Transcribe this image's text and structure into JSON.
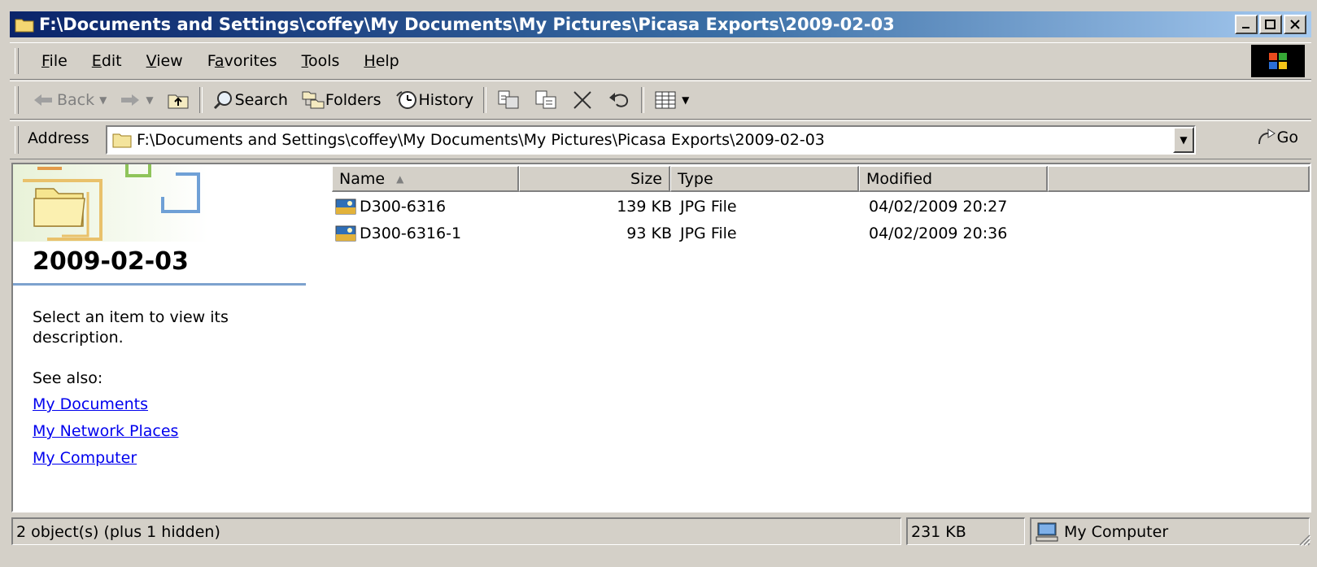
{
  "window": {
    "title": "F:\\Documents and Settings\\coffey\\My Documents\\My Pictures\\Picasa Exports\\2009-02-03"
  },
  "menu": [
    {
      "label": "File",
      "key": "F"
    },
    {
      "label": "Edit",
      "key": "E"
    },
    {
      "label": "View",
      "key": "V"
    },
    {
      "label": "Favorites",
      "key": "a"
    },
    {
      "label": "Tools",
      "key": "T"
    },
    {
      "label": "Help",
      "key": "H"
    }
  ],
  "toolbar": {
    "back_label": "Back",
    "search_label": "Search",
    "folders_label": "Folders",
    "history_label": "History"
  },
  "address": {
    "label": "Address",
    "value": "F:\\Documents and Settings\\coffey\\My Documents\\My Pictures\\Picasa Exports\\2009-02-03",
    "go_label": "Go"
  },
  "left_pane": {
    "folder_title": "2009-02-03",
    "description": "Select an item to view its description.",
    "see_also_label": "See also:",
    "links": [
      "My Documents",
      "My Network Places",
      "My Computer"
    ]
  },
  "columns": {
    "name": "Name",
    "size": "Size",
    "type": "Type",
    "modified": "Modified"
  },
  "files": [
    {
      "name": "D300-6316",
      "size": "139 KB",
      "type": "JPG File",
      "modified": "04/02/2009 20:27"
    },
    {
      "name": "D300-6316-1",
      "size": "93 KB",
      "type": "JPG File",
      "modified": "04/02/2009 20:36"
    }
  ],
  "status": {
    "objects": "2 object(s) (plus 1 hidden)",
    "size": "231 KB",
    "zone": "My Computer"
  },
  "colors": {
    "title_bar_start": "#0a246a",
    "title_bar_end": "#a6caf0",
    "link": "#0000ee",
    "chrome": "#d4d0c8"
  }
}
